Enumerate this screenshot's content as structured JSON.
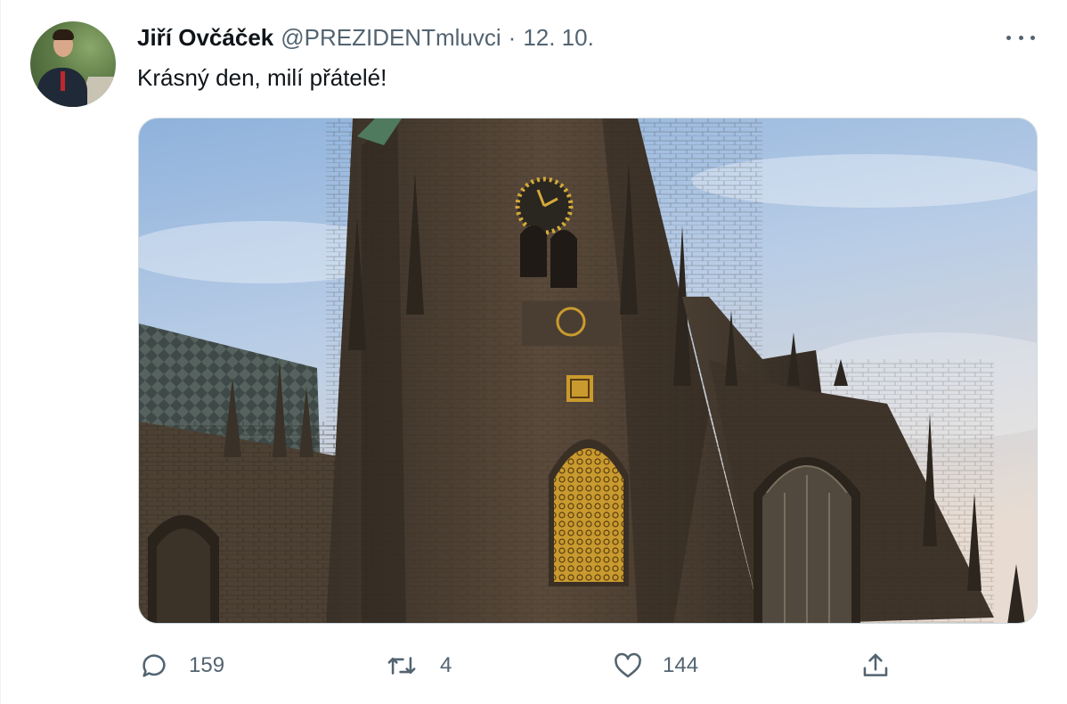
{
  "tweet": {
    "author_name": "Jiří Ovčáček",
    "handle": "@PREZIDENTmluvci",
    "separator": "·",
    "date": "12. 10.",
    "text": "Krásný den, milí přátelé!",
    "media_description": "Gothic cathedral tower against blue sky"
  },
  "actions": {
    "reply_count": "159",
    "retweet_count": "4",
    "like_count": "144"
  },
  "icons": {
    "avatar": "avatar-photo",
    "more": "more-icon",
    "reply": "reply-icon",
    "retweet": "retweet-icon",
    "like": "heart-icon",
    "share": "share-icon"
  },
  "colors": {
    "text_primary": "#0f1419",
    "text_secondary": "#536471",
    "border": "#cfd9de"
  }
}
